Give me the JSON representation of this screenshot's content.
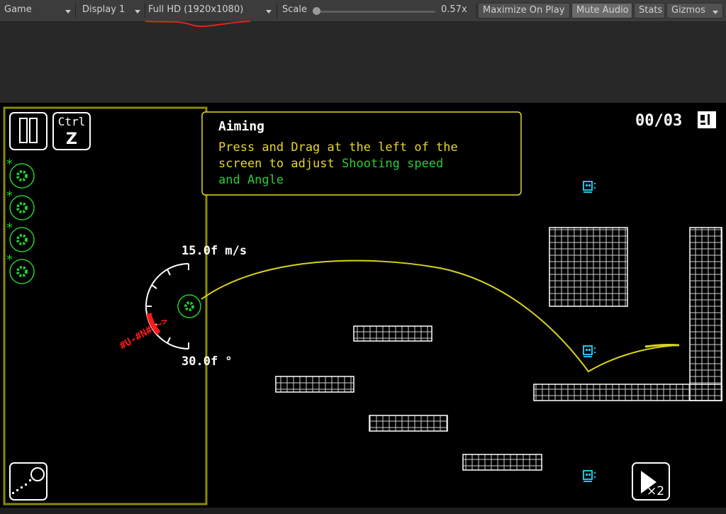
{
  "toolbar": {
    "game_tab": "Game",
    "display": "Display 1",
    "resolution": "Full HD (1920x1080)",
    "scale_label": "Scale",
    "scale_value": "0.57x",
    "scale_fraction": 0.0,
    "maximize": "Maximize On Play",
    "mute": "Mute Audio",
    "stats": "Stats",
    "gizmos": "Gizmos"
  },
  "hud": {
    "pause_icon": "pause-icon",
    "undo_key_top": "Ctrl",
    "undo_key_letter": "Z",
    "counter": "00/03",
    "counter_icon": "level-badge-icon",
    "fast_forward_label": "×2",
    "speed_label": "15.0f m/s",
    "angle_label": "30.0f °",
    "gauge_glyphs": "#U-#N#-~>"
  },
  "tutorial": {
    "title": "Aiming",
    "line1": "Press and Drag at the left of the",
    "line2_a": "screen to adjust ",
    "line2_b": "Shooting speed",
    "line3": "and Angle"
  },
  "colors": {
    "panel_border": "#8c8a00",
    "ball_green": "#1fcf36",
    "tutorial_yellow": "#e6d62e",
    "tutorial_green": "#2ccb3a",
    "trajectory": "#d8d41c",
    "gauge_red": "#ff1a1a",
    "robot_cyan": "#25c4e6"
  }
}
